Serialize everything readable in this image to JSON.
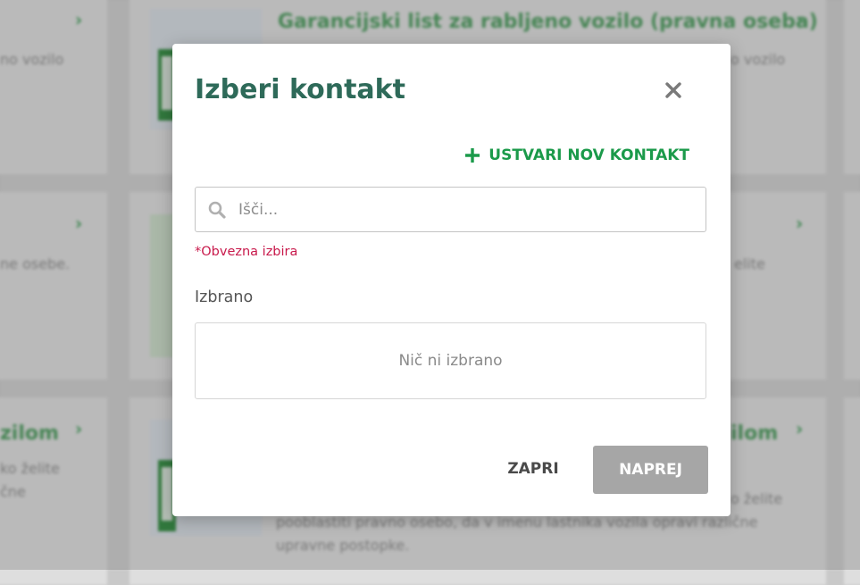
{
  "background": {
    "card_title_top": "Garancijski list za rabljeno vozilo (pravna oseba)",
    "left_text_1": "no vozilo",
    "right_text_1": "o vozilo",
    "left_text_2": "ne osebe.",
    "right_text_2": "elite",
    "left_title_3": "zilom",
    "right_title_3": "ilom",
    "left_text_3a": "ko želite",
    "left_text_3b": "čne",
    "bottom_text_a": "o želite",
    "bottom_text_b": "pooblastiti pravno osebo, da v imenu lastnika vozila opravi različne",
    "bottom_text_c": "upravne postopke."
  },
  "modal": {
    "title": "Izberi kontakt",
    "create_contact_label": "USTVARI NOV KONTAKT",
    "search_placeholder": "Išči...",
    "required_note": "*Obvezna izbira",
    "selected_label": "Izbrano",
    "empty_selection_text": "Nič ni izbrano",
    "close_button_label": "ZAPRI",
    "next_button_label": "NAPREJ"
  },
  "icons": {
    "close": "close-icon",
    "plus": "plus-icon",
    "search": "search-icon",
    "chevron": "chevron-right-icon"
  },
  "colors": {
    "title": "#2e6a59",
    "accent_green": "#1b9a4a",
    "required_red": "#c8194b",
    "disabled_button": "#a6a6a6"
  }
}
